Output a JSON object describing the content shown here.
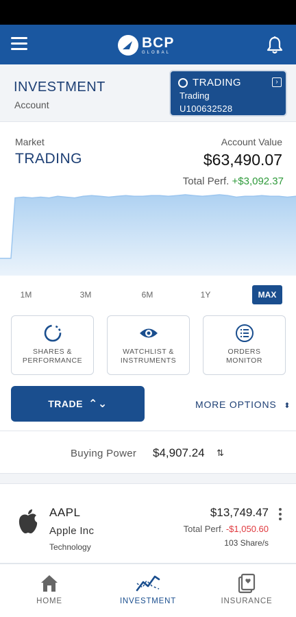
{
  "header": {
    "logo_text": "BCP",
    "logo_subtext": "GLOBAL",
    "icons": {
      "menu": "hamburger-menu-icon",
      "bell": "bell-icon"
    }
  },
  "account": {
    "title": "INVESTMENT",
    "subtitle": "Account",
    "selected": {
      "name": "TRADING",
      "type": "Trading",
      "id": "U100632528"
    }
  },
  "summary": {
    "market_label": "Market",
    "market_value": "TRADING",
    "account_value_label": "Account Value",
    "account_value": "$63,490.07",
    "total_perf_label": "Total Perf.",
    "total_perf_value": "+$3,092.37"
  },
  "chart_data": {
    "type": "area",
    "title": "",
    "xlabel": "",
    "ylabel": "",
    "series": [
      {
        "values": [
          20,
          20,
          96,
          97,
          96,
          97,
          96,
          98,
          97,
          96,
          98,
          99,
          98,
          97,
          98,
          99,
          98,
          98,
          99,
          99,
          98,
          99,
          100,
          99,
          98,
          99,
          100,
          99,
          97,
          98,
          98,
          99,
          98,
          98,
          97,
          98
        ]
      }
    ],
    "ylim": [
      0,
      100
    ],
    "grid": false,
    "legend": "none",
    "color": "#aacff1"
  },
  "ranges": {
    "items": [
      "1M",
      "3M",
      "6M",
      "1Y",
      "MAX"
    ],
    "active": "MAX"
  },
  "tiles": [
    {
      "label_line1": "SHARES &",
      "label_line2": "PERFORMANCE",
      "icon": "shares-performance-icon"
    },
    {
      "label_line1": "WATCHLIST &",
      "label_line2": "INSTRUMENTS",
      "icon": "eye-icon"
    },
    {
      "label_line1": "ORDERS",
      "label_line2": "MONITOR",
      "icon": "orders-list-icon"
    }
  ],
  "actions": {
    "trade_label": "TRADE",
    "trade_chevrons": "⌃⌄",
    "more_options_label": "MORE OPTIONS",
    "more_arrows": "⬍"
  },
  "buying_power": {
    "label": "Buying Power",
    "value": "$4,907.24",
    "switch_glyph": "⇅"
  },
  "position": {
    "ticker": "AAPL",
    "company": "Apple Inc",
    "sector": "Technology",
    "value": "$13,749.47",
    "perf_label": "Total Perf.",
    "perf_value": "-$1,050.60",
    "shares": "103 Share/s"
  },
  "nav": {
    "items": [
      {
        "label": "HOME",
        "icon": "home-icon"
      },
      {
        "label": "INVESTMENT",
        "icon": "chart-line-icon"
      },
      {
        "label": "INSURANCE",
        "icon": "insurance-card-icon"
      }
    ],
    "active": "INVESTMENT"
  },
  "colors": {
    "brand_blue": "#1a57a0",
    "dark_blue": "#1a4e8e",
    "positive": "#2e9a3a",
    "negative": "#e0393e",
    "chart_fill": "#aacff1"
  }
}
